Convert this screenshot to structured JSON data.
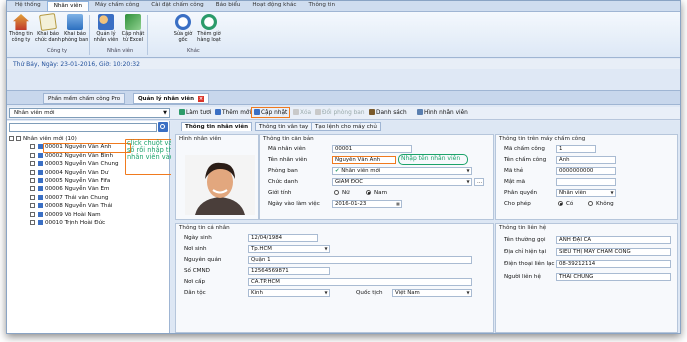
{
  "ribbon": {
    "tabs": [
      "Hệ thống",
      "Nhân viên",
      "Máy chấm công",
      "Cài đặt chấm công",
      "Báo biểu",
      "Hoạt động khác",
      "Thông tin"
    ],
    "buttons": [
      {
        "label": "Thông tin công ty",
        "icon": "house-icon"
      },
      {
        "label": "Khai báo chức danh",
        "icon": "title-icon"
      },
      {
        "label": "Khai báo phòng ban",
        "icon": "department-icon"
      },
      {
        "label": "Quản lý nhân viên",
        "icon": "users-icon"
      },
      {
        "label": "Cập nhật từ Excel",
        "icon": "excel-icon"
      },
      {
        "label": "Sửa giờ gốc",
        "icon": "clock-edit-icon"
      },
      {
        "label": "Thêm giờ hàng loạt",
        "icon": "clock-add-icon"
      }
    ],
    "groups": [
      "Công ty",
      "Nhân viên",
      "Khác"
    ]
  },
  "date_text": "Thứ Bảy, Ngày: 23-01-2016, Giờ: 10:20:32",
  "doc_tabs": [
    "Phần mềm chấm công Pro",
    "Quản lý nhân viên"
  ],
  "toolbar": {
    "filter_value": "Nhân viên mới",
    "buttons": [
      "Làm tươi",
      "Thêm mới",
      "Cập nhật",
      "Xóa",
      "Đổi phòng ban",
      "Danh sách",
      "Hình nhân viên"
    ]
  },
  "tree": {
    "root": "Nhân viên mới (10)",
    "items": [
      "00001 Nguyễn Văn Anh",
      "00002 Nguyễn Văn Bình",
      "00003 Nguyễn Văn Chung",
      "00004 Nguyễn Văn Dư",
      "00005 Nguyễn Văn Fifa",
      "00006 Nguyễn Văn Em",
      "00007 Thái văn Chung",
      "00008 Nguyễn Văn Thái",
      "00009 Võ Hoài Nam",
      "00010 Trịnh Hoài Đức"
    ]
  },
  "annotations": {
    "left_note": "click chuột vào mã số rồi nhập thông tin nhân viên vào",
    "right_note": "Nhập tên nhân viên"
  },
  "form_tabs": [
    "Thông tin nhân viên",
    "Thông tin vân tay",
    "Tạo lệnh cho máy chủ"
  ],
  "photo_title": "Hình nhân viên",
  "basic": {
    "title": "Thông tin căn bản",
    "employee_id_label": "Mã nhân viên",
    "employee_id": "00001",
    "name_label": "Tên nhân viên",
    "name": "Nguyễn Văn Anh",
    "department_label": "Phòng ban",
    "department": "Nhân viên mới",
    "position_label": "Chức danh",
    "position": "GIÁM ĐỐC",
    "gender_label": "Giới tính",
    "gender_female": "Nữ",
    "gender_male": "Nam",
    "start_date_label": "Ngày vào làm việc",
    "start_date": "2016-01-23"
  },
  "personal": {
    "title": "Thông tin cá nhân",
    "birth_date_label": "Ngày sinh",
    "birth_date": "12/04/1984",
    "birth_place_label": "Nơi sinh",
    "birth_place": "Tp.HCM",
    "hometown_label": "Nguyên quán",
    "hometown": "Quận 1",
    "id_number_label": "Số CMND",
    "id_number": "12564569871",
    "issue_place_label": "Nơi cấp",
    "issue_place": "CA.TP.HCM",
    "ethnicity_label": "Dân tộc",
    "ethnicity": "Kinh",
    "nationality_label": "Quốc tịch",
    "nationality": "Việt Nam"
  },
  "device": {
    "title": "Thông tin trên máy chấm công",
    "att_id_label": "Mã chấm công",
    "att_id": "1",
    "att_name_label": "Tên chấm công",
    "att_name": "Anh",
    "card_label": "Mã thẻ",
    "card": "0000000000",
    "password_label": "Mật mã",
    "password": "",
    "permission_label": "Phân quyền",
    "permission": "Nhân viên",
    "allow_label": "Cho phép",
    "allow_yes": "Có",
    "allow_no": "Không"
  },
  "contact": {
    "title": "Thông tin liên hệ",
    "nickname_label": "Tên thường gọi",
    "nickname": "ANH ĐẠI CA",
    "address_label": "Địa chỉ hiện tại",
    "address": "SIÊU THỊ MÁY CHẤM CÔNG",
    "phone_label": "Điện thoại liên lạc",
    "phone": "08-39212114",
    "contact_person_label": "Người liên hệ",
    "contact_person": "THÁI CHUNG"
  }
}
